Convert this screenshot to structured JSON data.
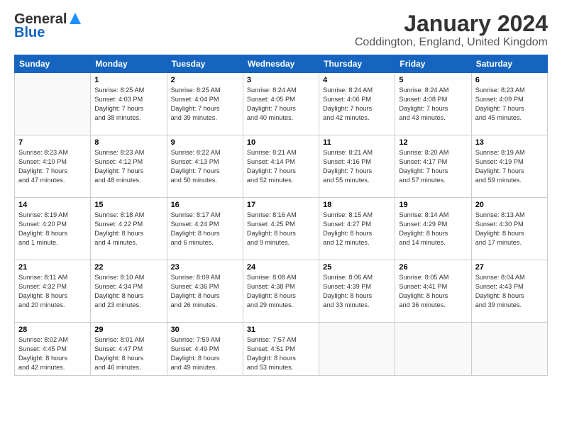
{
  "header": {
    "logo_line1": "General",
    "logo_line2": "Blue",
    "title": "January 2024",
    "subtitle": "Coddington, England, United Kingdom"
  },
  "days": [
    "Sunday",
    "Monday",
    "Tuesday",
    "Wednesday",
    "Thursday",
    "Friday",
    "Saturday"
  ],
  "weeks": [
    [
      {
        "date": "",
        "info": ""
      },
      {
        "date": "1",
        "info": "Sunrise: 8:25 AM\nSunset: 4:03 PM\nDaylight: 7 hours\nand 38 minutes."
      },
      {
        "date": "2",
        "info": "Sunrise: 8:25 AM\nSunset: 4:04 PM\nDaylight: 7 hours\nand 39 minutes."
      },
      {
        "date": "3",
        "info": "Sunrise: 8:24 AM\nSunset: 4:05 PM\nDaylight: 7 hours\nand 40 minutes."
      },
      {
        "date": "4",
        "info": "Sunrise: 8:24 AM\nSunset: 4:06 PM\nDaylight: 7 hours\nand 42 minutes."
      },
      {
        "date": "5",
        "info": "Sunrise: 8:24 AM\nSunset: 4:08 PM\nDaylight: 7 hours\nand 43 minutes."
      },
      {
        "date": "6",
        "info": "Sunrise: 8:23 AM\nSunset: 4:09 PM\nDaylight: 7 hours\nand 45 minutes."
      }
    ],
    [
      {
        "date": "7",
        "info": "Sunrise: 8:23 AM\nSunset: 4:10 PM\nDaylight: 7 hours\nand 47 minutes."
      },
      {
        "date": "8",
        "info": "Sunrise: 8:23 AM\nSunset: 4:12 PM\nDaylight: 7 hours\nand 48 minutes."
      },
      {
        "date": "9",
        "info": "Sunrise: 8:22 AM\nSunset: 4:13 PM\nDaylight: 7 hours\nand 50 minutes."
      },
      {
        "date": "10",
        "info": "Sunrise: 8:21 AM\nSunset: 4:14 PM\nDaylight: 7 hours\nand 52 minutes."
      },
      {
        "date": "11",
        "info": "Sunrise: 8:21 AM\nSunset: 4:16 PM\nDaylight: 7 hours\nand 55 minutes."
      },
      {
        "date": "12",
        "info": "Sunrise: 8:20 AM\nSunset: 4:17 PM\nDaylight: 7 hours\nand 57 minutes."
      },
      {
        "date": "13",
        "info": "Sunrise: 8:19 AM\nSunset: 4:19 PM\nDaylight: 7 hours\nand 59 minutes."
      }
    ],
    [
      {
        "date": "14",
        "info": "Sunrise: 8:19 AM\nSunset: 4:20 PM\nDaylight: 8 hours\nand 1 minute."
      },
      {
        "date": "15",
        "info": "Sunrise: 8:18 AM\nSunset: 4:22 PM\nDaylight: 8 hours\nand 4 minutes."
      },
      {
        "date": "16",
        "info": "Sunrise: 8:17 AM\nSunset: 4:24 PM\nDaylight: 8 hours\nand 6 minutes."
      },
      {
        "date": "17",
        "info": "Sunrise: 8:16 AM\nSunset: 4:25 PM\nDaylight: 8 hours\nand 9 minutes."
      },
      {
        "date": "18",
        "info": "Sunrise: 8:15 AM\nSunset: 4:27 PM\nDaylight: 8 hours\nand 12 minutes."
      },
      {
        "date": "19",
        "info": "Sunrise: 8:14 AM\nSunset: 4:29 PM\nDaylight: 8 hours\nand 14 minutes."
      },
      {
        "date": "20",
        "info": "Sunrise: 8:13 AM\nSunset: 4:30 PM\nDaylight: 8 hours\nand 17 minutes."
      }
    ],
    [
      {
        "date": "21",
        "info": "Sunrise: 8:11 AM\nSunset: 4:32 PM\nDaylight: 8 hours\nand 20 minutes."
      },
      {
        "date": "22",
        "info": "Sunrise: 8:10 AM\nSunset: 4:34 PM\nDaylight: 8 hours\nand 23 minutes."
      },
      {
        "date": "23",
        "info": "Sunrise: 8:09 AM\nSunset: 4:36 PM\nDaylight: 8 hours\nand 26 minutes."
      },
      {
        "date": "24",
        "info": "Sunrise: 8:08 AM\nSunset: 4:38 PM\nDaylight: 8 hours\nand 29 minutes."
      },
      {
        "date": "25",
        "info": "Sunrise: 8:06 AM\nSunset: 4:39 PM\nDaylight: 8 hours\nand 33 minutes."
      },
      {
        "date": "26",
        "info": "Sunrise: 8:05 AM\nSunset: 4:41 PM\nDaylight: 8 hours\nand 36 minutes."
      },
      {
        "date": "27",
        "info": "Sunrise: 8:04 AM\nSunset: 4:43 PM\nDaylight: 8 hours\nand 39 minutes."
      }
    ],
    [
      {
        "date": "28",
        "info": "Sunrise: 8:02 AM\nSunset: 4:45 PM\nDaylight: 8 hours\nand 42 minutes."
      },
      {
        "date": "29",
        "info": "Sunrise: 8:01 AM\nSunset: 4:47 PM\nDaylight: 8 hours\nand 46 minutes."
      },
      {
        "date": "30",
        "info": "Sunrise: 7:59 AM\nSunset: 4:49 PM\nDaylight: 8 hours\nand 49 minutes."
      },
      {
        "date": "31",
        "info": "Sunrise: 7:57 AM\nSunset: 4:51 PM\nDaylight: 8 hours\nand 53 minutes."
      },
      {
        "date": "",
        "info": ""
      },
      {
        "date": "",
        "info": ""
      },
      {
        "date": "",
        "info": ""
      }
    ]
  ]
}
